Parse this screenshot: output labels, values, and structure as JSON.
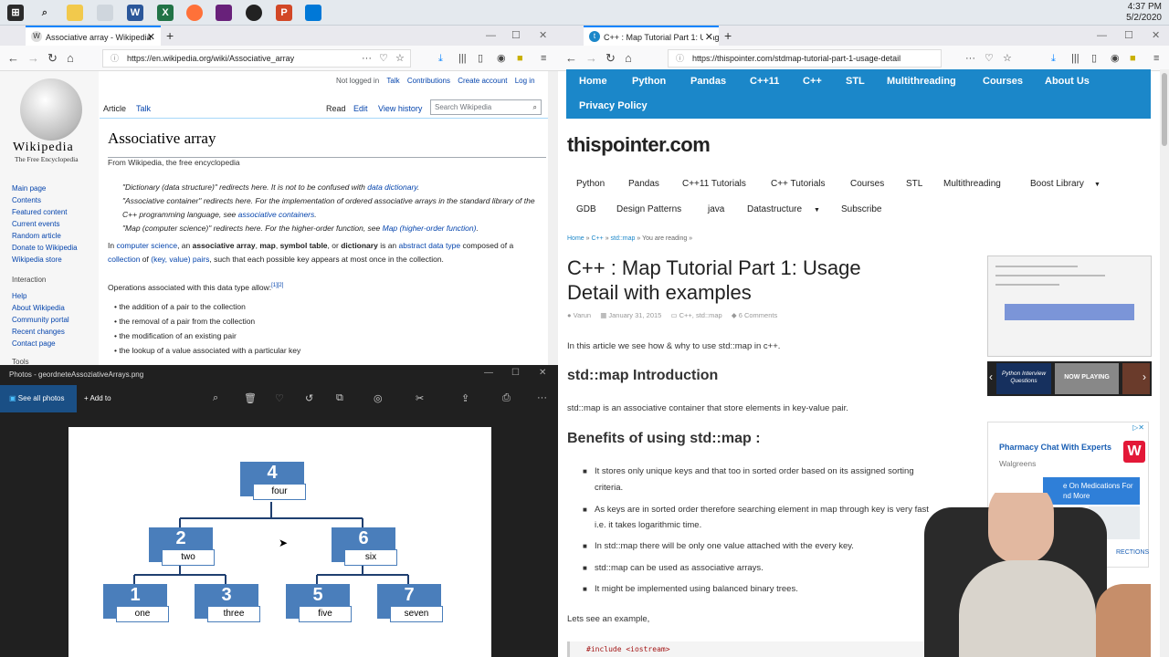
{
  "clock": {
    "time": "4:37 PM",
    "date": "5/2/2020"
  },
  "left_browser": {
    "tab_title": "Associative array - Wikipedia",
    "url": "https://en.wikipedia.org/wiki/Associative_array"
  },
  "wiki": {
    "logo_text": "Wikipedia",
    "tagline": "The Free Encyclopedia",
    "user_links": [
      "Not logged in",
      "Talk",
      "Contributions",
      "Create account",
      "Log in"
    ],
    "tabs": [
      "Article",
      "Talk"
    ],
    "actions": [
      "Read",
      "Edit",
      "View history"
    ],
    "search_placeholder": "Search Wikipedia",
    "side_main": [
      "Main page",
      "Contents",
      "Featured content",
      "Current events",
      "Random article",
      "Donate to Wikipedia",
      "Wikipedia store"
    ],
    "side_interaction_title": "Interaction",
    "side_interaction": [
      "Help",
      "About Wikipedia",
      "Community portal",
      "Recent changes",
      "Contact page"
    ],
    "side_tools_title": "Tools",
    "title": "Associative array",
    "subtitle": "From Wikipedia, the free encyclopedia",
    "hat1_pre": "\"Dictionary (data structure)\" redirects here. It is not to be confused with ",
    "hat1_link": "data dictionary",
    "hat1_post": ".",
    "hat2_pre": "\"Associative container\" redirects here. For the implementation of ordered associative arrays in the standard library of the C++ programming language, see ",
    "hat2_link": "associative containers",
    "hat2_post": ".",
    "hat3_pre": "\"Map (computer science)\" redirects here. For the higher-order function, see ",
    "hat3_link": "Map (higher-order function)",
    "hat3_post": ".",
    "p1_a": "In ",
    "p1_link1": "computer science",
    "p1_b": ", an ",
    "p1_t1": "associative array",
    "p1_c": ", ",
    "p1_t2": "map",
    "p1_d": ", ",
    "p1_t3": "symbol table",
    "p1_e": ", or ",
    "p1_t4": "dictionary",
    "p1_f": " is an ",
    "p1_link2": "abstract data type",
    "p1_g": " composed of a ",
    "p1_link3": "collection",
    "p1_h": " of ",
    "p1_link4": "(key, value) pairs",
    "p1_i": ", such that each possible key appears at most once in the collection.",
    "p2": "Operations associated with this data type allow:",
    "p2_refs": "[1][2]",
    "ops": [
      "the addition of a pair to the collection",
      "the removal of a pair from the collection",
      "the modification of an existing pair",
      "the lookup of a value associated with a particular key"
    ]
  },
  "photos": {
    "title": "Photos - geordneteAssoziativeArrays.png",
    "see_all": "See all photos",
    "add_to": "Add to",
    "nodes": [
      {
        "num": "4",
        "word": "four"
      },
      {
        "num": "2",
        "word": "two"
      },
      {
        "num": "6",
        "word": "six"
      },
      {
        "num": "1",
        "word": "one"
      },
      {
        "num": "3",
        "word": "three"
      },
      {
        "num": "5",
        "word": "five"
      },
      {
        "num": "7",
        "word": "seven"
      }
    ]
  },
  "right_browser": {
    "tab_title": "C++ : Map Tutorial Part 1: Usag",
    "url": "https://thispointer.com/stdmap-tutorial-part-1-usage-detail"
  },
  "site": {
    "top_nav": [
      "Home",
      "Python",
      "Pandas",
      "C++11",
      "C++",
      "STL",
      "Multithreading",
      "Courses",
      "About Us",
      "Privacy Policy"
    ],
    "logo": "thispointer.com",
    "menu1": [
      "Python",
      "Pandas",
      "C++11 Tutorials",
      "C++ Tutorials",
      "Courses",
      "STL",
      "Multithreading",
      "Boost Library"
    ],
    "menu2": [
      "GDB",
      "Design Patterns",
      "java",
      "Datastructure",
      "Subscribe"
    ],
    "breadcrumb": [
      "Home",
      "»",
      "C++",
      "»",
      "std::map",
      "»",
      "You are reading",
      "»"
    ],
    "title_line1": "C++ : Map Tutorial Part 1: Usage",
    "title_line2": "Detail with examples",
    "author": "Varun",
    "date": "January 31, 2015",
    "cats": "C++, std::map",
    "comments": "6 Comments",
    "intro": "In this article we see how & why to use std::map in c++.",
    "h_intro": "std::map Introduction",
    "p_intro": "std::map is an associative container that store elements in key-value pair.",
    "h_benefits": "Benefits of using std::map :",
    "benefits": [
      "It stores only unique keys and that too in sorted order based on its assigned sorting",
      "criteria.",
      "As keys are in sorted order therefore searching element in map through key is very fast",
      "i.e. it takes logarithmic time.",
      "In std::map there will be only one value attached with the every key.",
      "std::map can be used as associative arrays.",
      "It might be implemented using balanced binary trees."
    ],
    "lets_see": "Lets see an example,",
    "code1": "#include <iostream>"
  },
  "video": {
    "thumb1": "Python Interview Questions",
    "thumb2": "NOW PLAYING"
  },
  "ad": {
    "title": "Pharmacy Chat With Experts",
    "brand": "Walgreens",
    "line1": "e On Medications For",
    "line2": "nd More",
    "footer": "RECTIONS"
  },
  "colors": {
    "site_blue": "#1b87c9",
    "wiki_link": "#0645ad",
    "firefox_accent": "#0a84ff"
  }
}
